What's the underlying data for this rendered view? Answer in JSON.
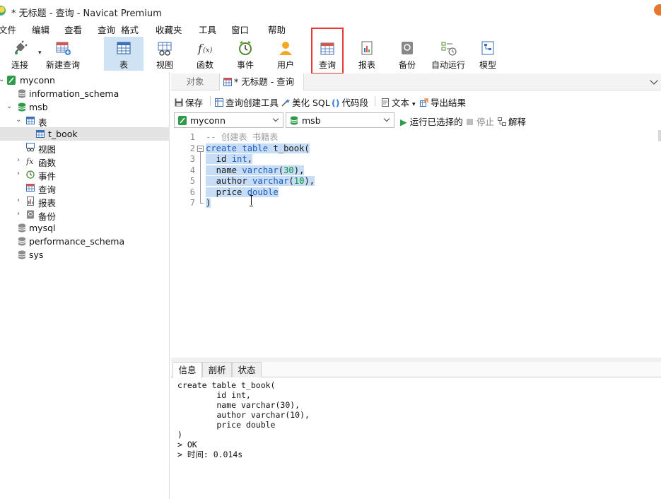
{
  "window": {
    "title": "* 无标题 - 查询 - Navicat Premium"
  },
  "menu": [
    "文件",
    "编辑",
    "查看",
    "查询",
    "格式",
    "收藏夹",
    "工具",
    "窗口",
    "帮助"
  ],
  "toolbar": {
    "connect": "连接",
    "new_query": "新建查询",
    "table": "表",
    "view": "视图",
    "function": "函数",
    "event": "事件",
    "user": "用户",
    "query": "查询",
    "report": "报表",
    "backup": "备份",
    "auto_run": "自动运行",
    "model": "模型"
  },
  "tree": {
    "connection": "myconn",
    "databases": [
      "information_schema",
      "msb",
      "mysql",
      "performance_schema",
      "sys"
    ],
    "msb_children": {
      "tables": "表",
      "table_items": [
        "t_book"
      ],
      "views": "视图",
      "functions": "函数",
      "events": "事件",
      "queries": "查询",
      "reports": "报表",
      "backups": "备份"
    }
  },
  "tabs": {
    "objects": "对象",
    "query_tab": "* 无标题 - 查询"
  },
  "query_toolbar": {
    "save": "保存",
    "query_builder": "查询创建工具",
    "beautify": "美化 SQL",
    "snippet": "代码段",
    "text": "文本",
    "export": "导出结果"
  },
  "selectors": {
    "connection": "myconn",
    "database": "msb",
    "run_selected": "运行已选择的",
    "stop": "停止",
    "explain": "解释"
  },
  "editor": {
    "line_numbers": [
      "1",
      "2",
      "3",
      "4",
      "5",
      "6",
      "7"
    ],
    "lines": [
      "-- 创建表 书籍表",
      "create table t_book(",
      "  id int,",
      "  name varchar(30),",
      "  author varchar(10),",
      "  price double",
      ")"
    ]
  },
  "results": {
    "tabs": [
      "信息",
      "剖析",
      "状态"
    ],
    "messages": [
      "create table t_book(",
      "        id int,",
      "        name varchar(30),",
      "        author varchar(10),",
      "        price double",
      ")",
      "> OK",
      "> 时间: 0.014s"
    ]
  },
  "colors": {
    "accent_selected": "#cfe3f5",
    "highlight_border": "#e53935",
    "keyword": "#1c5dbf",
    "number": "#0a8f3c",
    "comment": "#9e9e9e",
    "selection": "#c7dcf5"
  }
}
